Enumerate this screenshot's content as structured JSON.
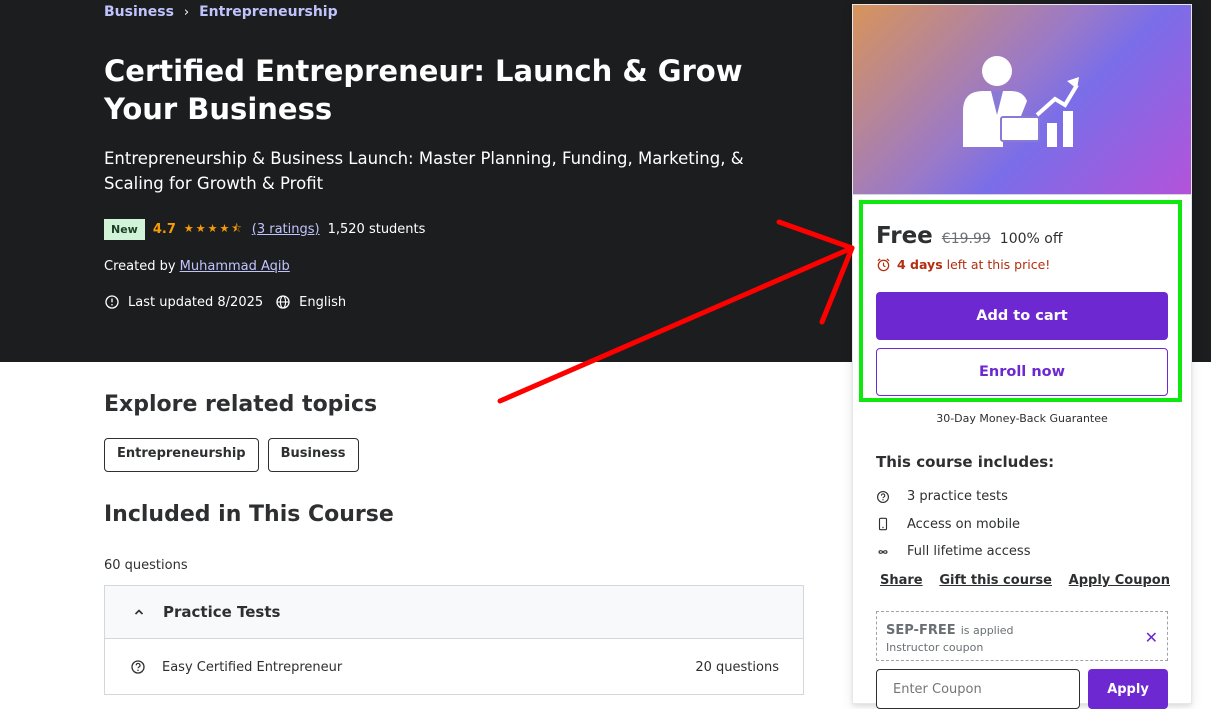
{
  "breadcrumb": {
    "items": [
      "Business",
      "Entrepreneurship"
    ]
  },
  "course": {
    "title": "Certified Entrepreneur: Launch & Grow Your Business",
    "subtitle": "Entrepreneurship & Business Launch: Master Planning, Funding, Marketing, & Scaling for Growth & Profit",
    "badge": "New",
    "rating": "4.7",
    "stars_value": 4.7,
    "ratings_count": "(3 ratings)",
    "students": "1,520 students",
    "created_by_label": "Created by",
    "author": "Muhammad Aqib",
    "last_updated": "Last updated 8/2025",
    "language": "English"
  },
  "explore": {
    "heading": "Explore related topics",
    "topics": [
      "Entrepreneurship",
      "Business"
    ]
  },
  "included": {
    "heading": "Included in This Course",
    "question_count": "60 questions",
    "section_title": "Practice Tests",
    "rows": [
      {
        "label": "Easy Certified Entrepreneur",
        "count": "20 questions"
      }
    ]
  },
  "sidebar": {
    "price": "Free",
    "old_price": "€19.99",
    "discount": "100% off",
    "timer_bold": "4 days",
    "timer_rest": "left at this price!",
    "add_to_cart": "Add to cart",
    "enroll_now": "Enroll now",
    "guarantee": "30-Day Money-Back Guarantee",
    "includes_heading": "This course includes:",
    "includes": [
      {
        "icon": "question-circle-icon",
        "label": "3 practice tests"
      },
      {
        "icon": "mobile-icon",
        "label": "Access on mobile"
      },
      {
        "icon": "infinity-icon",
        "label": "Full lifetime access"
      }
    ],
    "links": [
      "Share",
      "Gift this course",
      "Apply Coupon"
    ],
    "coupon": {
      "code": "SEP-FREE",
      "applied": "is applied",
      "type": "Instructor coupon",
      "input_placeholder": "Enter Coupon",
      "apply": "Apply"
    }
  },
  "colors": {
    "accent": "#6d28d2",
    "rating": "#f69c08",
    "timer": "#b32d0f",
    "annotation_box": "#0ee80e",
    "annotation_arrow": "#ff0000"
  }
}
